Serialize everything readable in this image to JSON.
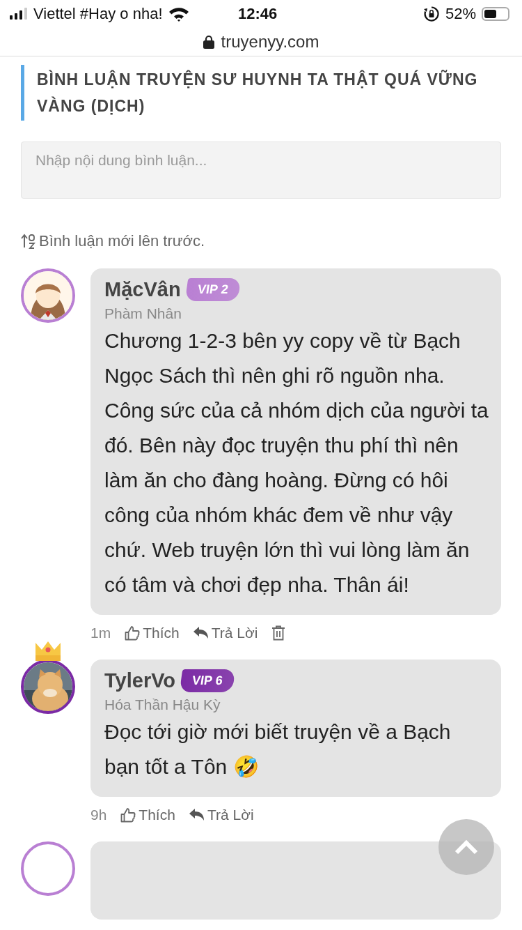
{
  "status_bar": {
    "carrier": "Viettel #Hay o nha!",
    "time": "12:46",
    "battery": "52%"
  },
  "address_bar": {
    "url": "truyenyy.com"
  },
  "heading": "BÌNH LUẬN TRUYỆN SƯ HUYNH TA THẬT QUÁ VỮNG VÀNG (DỊCH)",
  "comment_input": {
    "placeholder": "Nhập nội dung bình luận..."
  },
  "sort": {
    "label": "Bình luận mới lên trước."
  },
  "comments": [
    {
      "name": "MặcVân",
      "vip": "VIP 2",
      "color": "#b97fd3",
      "crowned": false,
      "rank": "Phàm Nhân",
      "text": "Chương 1-2-3 bên yy copy về từ Bạch Ngọc Sách thì nên ghi rõ nguồn nha. Công sức của cả nhóm dịch của người ta đó. Bên này đọc truyện thu phí thì nên làm ăn cho đàng hoàng. Đừng có hôi công của nhóm khác đem về như vậy chứ. Web truyện lớn thì vui lòng làm ăn có tâm và chơi đẹp nha. Thân ái!",
      "time": "1m",
      "like": "Thích",
      "reply": "Trả Lời",
      "can_delete": true
    },
    {
      "name": "TylerVo",
      "vip": "VIP 6",
      "color": "#7b2aa5",
      "crowned": true,
      "rank": "Hóa Thần Hậu Kỳ",
      "text": "Đọc tới giờ mới biết truyện về a Bạch bạn tốt a Tôn 🤣",
      "time": "9h",
      "like": "Thích",
      "reply": "Trả Lời",
      "can_delete": false
    }
  ]
}
